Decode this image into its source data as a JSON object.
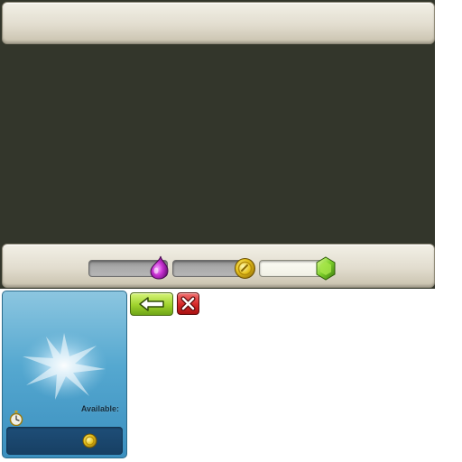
{
  "colors": {
    "panel_background": "#33362b",
    "bar_light": "#f2f0e6",
    "track_dark": "#a9a9a9",
    "track_light": "#f1f1e6",
    "card_blue": "#55a8d0",
    "card_footer": "#1e4e78",
    "back_button_green": "#9fd22c",
    "close_button_red": "#d52828"
  },
  "resources": [
    {
      "name": "elixir",
      "icon": "elixir-drop-icon",
      "color": "#c62fd0",
      "level": 0
    },
    {
      "name": "gold",
      "icon": "gold-coin-icon",
      "color": "#e6c21c",
      "level": 0
    },
    {
      "name": "gems",
      "icon": "gem-icon",
      "color": "#7ccf2a",
      "level": 1
    }
  ],
  "card": {
    "available_label": "Available:",
    "timer_icon": "stopwatch-icon",
    "cost_icon": "gold-coin-icon"
  },
  "buttons": {
    "back_icon": "back-arrow-icon",
    "close_icon": "close-x-icon"
  }
}
